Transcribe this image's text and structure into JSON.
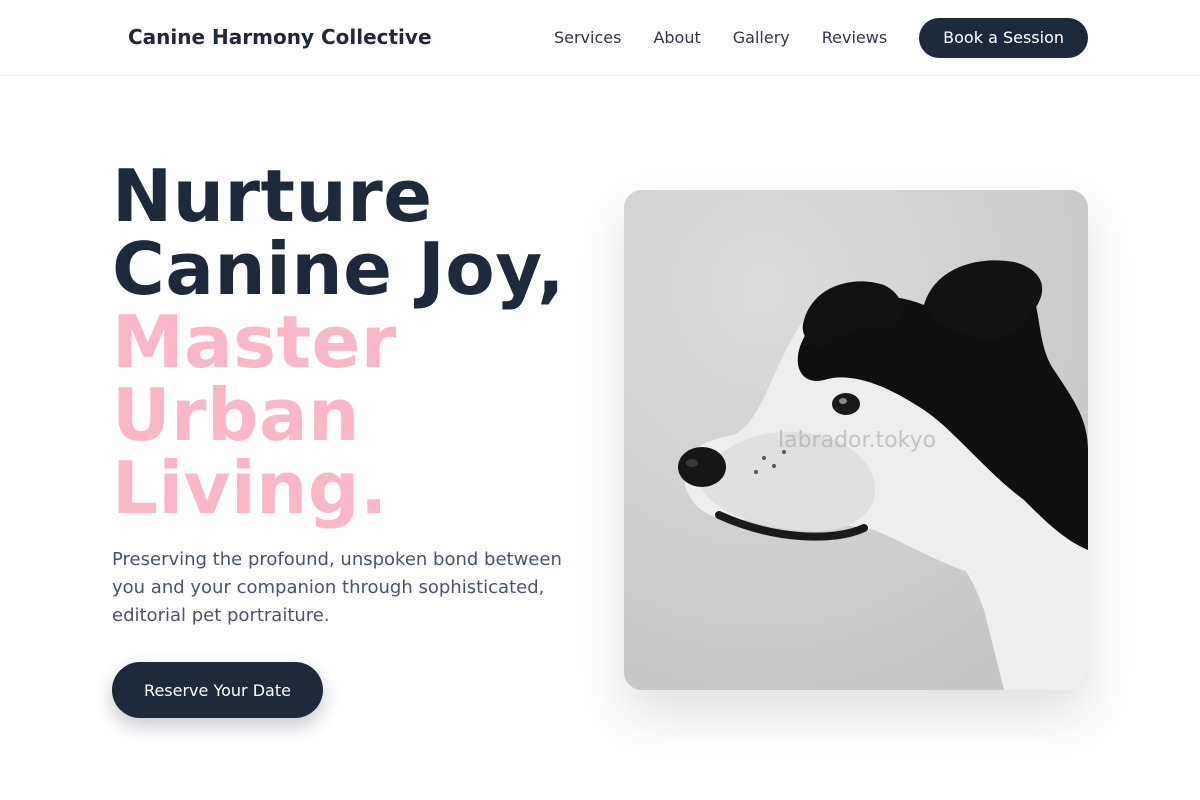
{
  "header": {
    "brand": "Canine Harmony Collective",
    "nav": [
      "Services",
      "About",
      "Gallery",
      "Reviews"
    ],
    "cta": "Book a Session"
  },
  "hero": {
    "title_dark": [
      "Nurture",
      "Canine Joy,"
    ],
    "title_accent": [
      "Master",
      "Urban",
      "Living."
    ],
    "subtitle": "Preserving the profound, unspoken bond between you and your companion through sophisticated, editorial pet portraiture.",
    "cta": "Reserve Your Date",
    "image": {
      "watermark": "labrador.tokyo",
      "subject": "dog-portrait"
    }
  },
  "colors": {
    "navy": "#1e293b",
    "accent_pink": "#fbb6c8",
    "body_text": "#475569"
  }
}
